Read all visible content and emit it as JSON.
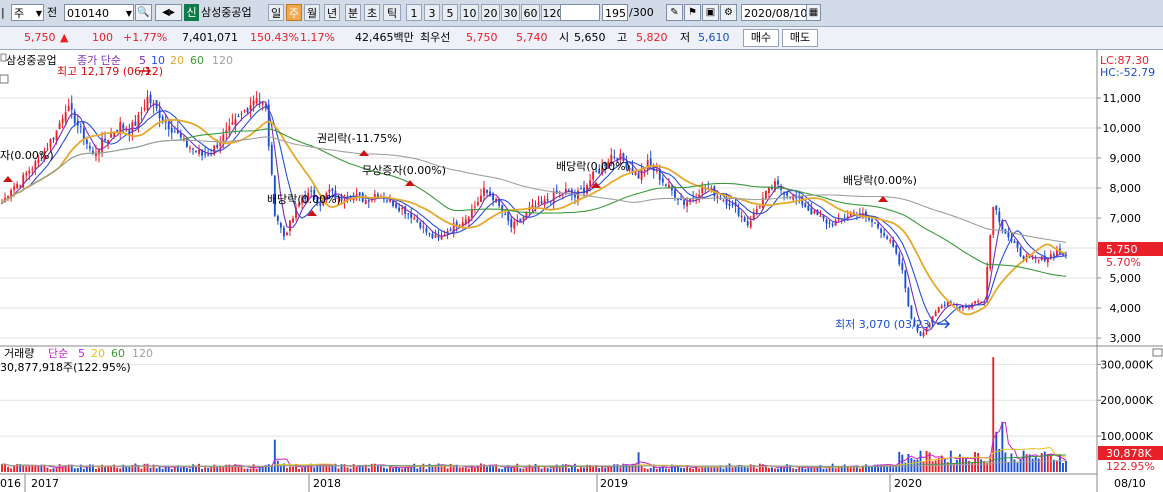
{
  "toolbar": {
    "nav_left": "|",
    "period_select": "주",
    "prev_label": "전",
    "code_value": "010140",
    "company_badge": "신",
    "company_name": "삼성중공업",
    "periods": [
      {
        "label": "일",
        "selected": false
      },
      {
        "label": "주",
        "selected": true
      },
      {
        "label": "월",
        "selected": false
      },
      {
        "label": "년",
        "selected": false
      },
      {
        "label": "분",
        "selected": false
      },
      {
        "label": "초",
        "selected": false
      },
      {
        "label": "틱",
        "selected": false
      }
    ],
    "intervals": [
      "1",
      "3",
      "5",
      "10",
      "20",
      "30",
      "60",
      "120"
    ],
    "count_value": "195",
    "count_total": "/300",
    "date_value": "2020/08/10"
  },
  "infobar": {
    "price": "5,750",
    "change_arrow": "▲",
    "change": "100",
    "change_pct": "+1.77%",
    "volume": "7,401,071",
    "volume_ratio": "150.43%",
    "turnover": "1.17%",
    "amount": "42,465백만",
    "best_label": "최우선",
    "best_ask": "5,750",
    "best_bid": "5,740",
    "open_label": "시",
    "open": "5,650",
    "high_label": "고",
    "high": "5,820",
    "low_label": "저",
    "low": "5,610",
    "buy_label": "매수",
    "sell_label": "매도"
  },
  "price_panel": {
    "legend_name": "삼성중공업",
    "legend_series_label": "종가 단순",
    "ma_periods": [
      "5",
      "10",
      "20",
      "60",
      "120"
    ],
    "ma_colors": [
      "#7a2fb8",
      "#2a4fd8",
      "#e6a92a",
      "#3a9a3a",
      "#a0a0a0"
    ],
    "lc_label": "LC:87.30",
    "hc_label": "HC:-52.79",
    "y_ticks": [
      "3,000",
      "4,000",
      "5,000",
      "6,000",
      "7,000",
      "8,000",
      "9,000",
      "10,000",
      "11,000"
    ],
    "current_price_tag": "5,750",
    "current_pct_tag": "5.70%",
    "high_marker": "최고 12,179 (06/12)",
    "low_marker": "최저 3,070 (03/23)",
    "annotations": [
      "자(0.00%)",
      "권리락(-11.75%)",
      "무상증자(0.00%)",
      "배당락(0.00%)",
      "배당락(0.00%)",
      "배당락(0.00%)"
    ]
  },
  "volume_panel": {
    "legend_title": "거래량",
    "legend_series_label": "단순",
    "ma_periods": [
      "5",
      "20",
      "60",
      "120"
    ],
    "ma_colors": [
      "#d020d0",
      "#e6c020",
      "#3a9a3a",
      "#a0a0a0"
    ],
    "summary": "30,877,918주(122.95%)",
    "y_ticks": [
      "300,000K",
      "200,000K",
      "100,000K"
    ],
    "current_tag": "30,878K",
    "current_pct_tag": "122.95%"
  },
  "x_axis": {
    "labels": [
      "016",
      "2017",
      "2018",
      "2019",
      "2020",
      "08/10"
    ]
  },
  "chart_data": {
    "type": "candlestick",
    "period": "weekly",
    "price_range": [
      2800,
      12600
    ],
    "volume_max_k": 340000,
    "close_series": [
      [
        0,
        7500
      ],
      [
        3,
        8000
      ],
      [
        6,
        8200
      ],
      [
        9,
        8600
      ],
      [
        12,
        8900
      ],
      [
        15,
        9400
      ],
      [
        18,
        9900
      ],
      [
        21,
        10700
      ],
      [
        24,
        10300
      ],
      [
        27,
        9700
      ],
      [
        30,
        9100
      ],
      [
        33,
        9500
      ],
      [
        36,
        9800
      ],
      [
        39,
        10100
      ],
      [
        42,
        9900
      ],
      [
        45,
        10300
      ],
      [
        48,
        11000
      ],
      [
        51,
        10600
      ],
      [
        54,
        10200
      ],
      [
        57,
        9900
      ],
      [
        60,
        9500
      ],
      [
        63,
        9300
      ],
      [
        66,
        9100
      ],
      [
        69,
        9200
      ],
      [
        72,
        9600
      ],
      [
        75,
        9900
      ],
      [
        78,
        10300
      ],
      [
        81,
        10700
      ],
      [
        84,
        11100
      ],
      [
        87,
        10600
      ],
      [
        90,
        7200
      ],
      [
        93,
        6400
      ],
      [
        96,
        7000
      ],
      [
        99,
        7700
      ],
      [
        102,
        7800
      ],
      [
        105,
        7500
      ],
      [
        108,
        7900
      ],
      [
        111,
        7600
      ],
      [
        114,
        7800
      ],
      [
        117,
        7700
      ],
      [
        120,
        7600
      ],
      [
        123,
        7800
      ],
      [
        126,
        7700
      ],
      [
        129,
        7500
      ],
      [
        132,
        7300
      ],
      [
        135,
        7100
      ],
      [
        138,
        6800
      ],
      [
        141,
        6400
      ],
      [
        144,
        6300
      ],
      [
        147,
        6600
      ],
      [
        150,
        6800
      ],
      [
        153,
        7000
      ],
      [
        156,
        7400
      ],
      [
        159,
        7900
      ],
      [
        162,
        7700
      ],
      [
        165,
        7200
      ],
      [
        168,
        6700
      ],
      [
        171,
        6900
      ],
      [
        174,
        7300
      ],
      [
        177,
        7400
      ],
      [
        180,
        7600
      ],
      [
        183,
        7800
      ],
      [
        186,
        7900
      ],
      [
        189,
        7700
      ],
      [
        192,
        8000
      ],
      [
        195,
        8400
      ],
      [
        198,
        8700
      ],
      [
        201,
        9100
      ],
      [
        204,
        9000
      ],
      [
        207,
        8700
      ],
      [
        210,
        8400
      ],
      [
        213,
        8800
      ],
      [
        216,
        8500
      ],
      [
        219,
        8100
      ],
      [
        222,
        7800
      ],
      [
        225,
        7500
      ],
      [
        228,
        7700
      ],
      [
        231,
        8000
      ],
      [
        234,
        7900
      ],
      [
        237,
        7700
      ],
      [
        240,
        7500
      ],
      [
        243,
        7200
      ],
      [
        246,
        6800
      ],
      [
        249,
        7300
      ],
      [
        252,
        7800
      ],
      [
        255,
        8100
      ],
      [
        258,
        7900
      ],
      [
        261,
        7700
      ],
      [
        264,
        7500
      ],
      [
        267,
        7200
      ],
      [
        270,
        7000
      ],
      [
        273,
        6800
      ],
      [
        276,
        6900
      ],
      [
        279,
        7100
      ],
      [
        282,
        7200
      ],
      [
        285,
        7000
      ],
      [
        288,
        6800
      ],
      [
        291,
        6500
      ],
      [
        294,
        6000
      ],
      [
        297,
        5200
      ],
      [
        300,
        3600
      ],
      [
        303,
        3100
      ],
      [
        306,
        3500
      ],
      [
        309,
        4000
      ],
      [
        312,
        4200
      ],
      [
        315,
        4100
      ],
      [
        318,
        4000
      ],
      [
        321,
        4200
      ],
      [
        324,
        4300
      ],
      [
        327,
        7500
      ],
      [
        330,
        6700
      ],
      [
        333,
        6200
      ],
      [
        336,
        5800
      ],
      [
        339,
        5600
      ],
      [
        342,
        5600
      ],
      [
        345,
        5700
      ],
      [
        348,
        5900
      ],
      [
        351,
        5750
      ]
    ],
    "volume_spikes_k": [
      [
        90,
        90000
      ],
      [
        210,
        55000
      ],
      [
        327,
        320000
      ],
      [
        330,
        140000
      ]
    ],
    "current_price": 5750,
    "current_volume_k": 30878
  }
}
